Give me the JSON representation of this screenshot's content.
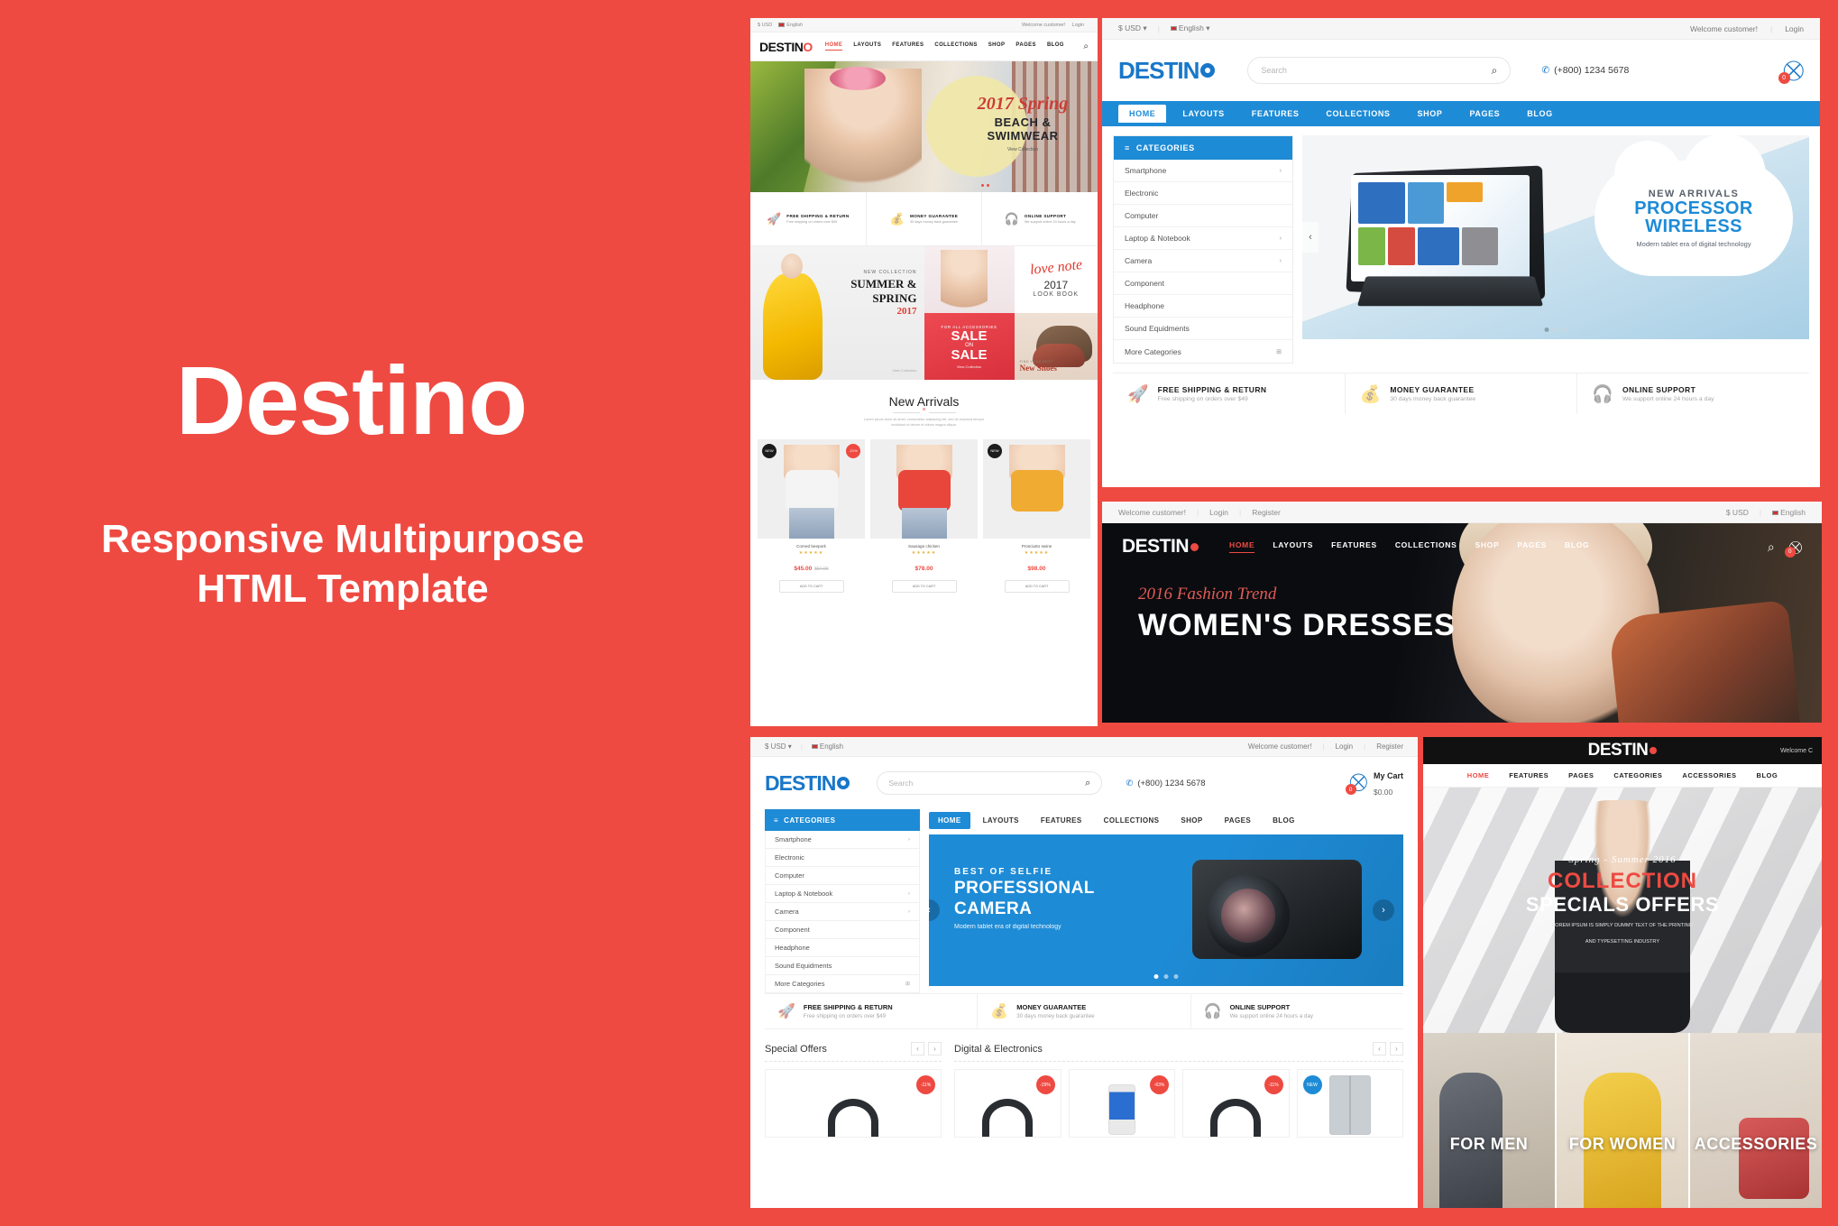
{
  "brand": {
    "name": "Destino",
    "accent": "#ee4a42",
    "blue": "#1e8bd6"
  },
  "hero": {
    "title": "Destino",
    "subtitle": "Responsive Multipurpose\nHTML Template",
    "subtitle_line1": "Responsive Multipurpose",
    "subtitle_line2": "HTML Template"
  },
  "common": {
    "currency": "$ USD",
    "language": "English",
    "welcome": "Welcome customer!",
    "login": "Login",
    "register": "Register",
    "search_placeholder": "Search",
    "phone": "(+800) 1234 5678",
    "cart_count": "0",
    "cart_label": "My Cart",
    "cart_total": "$0.00",
    "categories_title": "CATEGORIES",
    "caret": "▾",
    "arrow_right": "›",
    "arrow_left": "‹",
    "plus": "⊞"
  },
  "categories": [
    {
      "label": "Smartphone",
      "has_sub": true
    },
    {
      "label": "Electronic",
      "has_sub": false
    },
    {
      "label": "Computer",
      "has_sub": false
    },
    {
      "label": "Laptop & Notebook",
      "has_sub": true
    },
    {
      "label": "Camera",
      "has_sub": true
    },
    {
      "label": "Component",
      "has_sub": false
    },
    {
      "label": "Headphone",
      "has_sub": false
    },
    {
      "label": "Sound Equidments",
      "has_sub": false
    },
    {
      "label": "More Categories",
      "has_sub": false
    }
  ],
  "services": [
    {
      "title": "FREE SHIPPING & RETURN",
      "sub": "Free shipping on orders over $49",
      "icon": "rocket-icon"
    },
    {
      "title": "MONEY GUARANTEE",
      "sub": "30 days money back guarantee",
      "icon": "money-bag-icon"
    },
    {
      "title": "ONLINE SUPPORT",
      "sub": "We support online 24 hours a day",
      "icon": "headset-icon"
    }
  ],
  "panel_fashion_light": {
    "nav": [
      "HOME",
      "LAYOUTS",
      "FEATURES",
      "COLLECTIONS",
      "SHOP",
      "PAGES",
      "BLOG"
    ],
    "active_nav": "HOME",
    "logo": "DESTINO",
    "hero": {
      "script_line": "2017 Spring",
      "headline_line1": "BEACH &",
      "headline_line2": "SWIMWEAR",
      "cta": "View Collection"
    },
    "promos": {
      "summer": {
        "kicker": "NEW COLLECTION",
        "title": "SUMMER & SPRING",
        "year": "2017",
        "cta": "View Collection"
      },
      "lookbook": {
        "script": "love note",
        "year": "2017",
        "label": "LOOK BOOK"
      },
      "sale": {
        "kicker": "FOR ALL ACCESSORIES",
        "l1": "SALE",
        "l2": "ON",
        "l3": "SALE",
        "cta": "View Collection"
      },
      "shoes": {
        "kicker": "FIND YOUR BEST",
        "title": "New Shoes"
      }
    },
    "new_arrivals": {
      "heading": "New Arrivals",
      "sub_line1": "Lorem ipsum dolor sit amet, consectetur adipiscing elit, sed do eiusmod tempor",
      "sub_line2": "incididunt ut labore et dolore magna aliqua.",
      "products": [
        {
          "name": "Corned beepork",
          "stars": "★★★★★",
          "price": "$45.00",
          "old_price": "$57.00",
          "badge_new": "NEW",
          "badge_off": "-21%",
          "cta": "ADD TO CART"
        },
        {
          "name": "Sausage chicken",
          "stars": "★★★★★",
          "price": "$78.00",
          "old_price": "",
          "badge_new": "",
          "badge_off": "",
          "cta": "ADD TO CART"
        },
        {
          "name": "Prosciutto swine",
          "stars": "★★★★★",
          "price": "$98.00",
          "old_price": "",
          "badge_new": "NEW",
          "badge_off": "",
          "cta": "ADD TO CART"
        }
      ]
    }
  },
  "panel_electronics_top": {
    "logo": "DESTINO",
    "nav": [
      "HOME",
      "LAYOUTS",
      "FEATURES",
      "COLLECTIONS",
      "SHOP",
      "PAGES",
      "BLOG"
    ],
    "active_nav": "HOME",
    "banner": {
      "kicker": "NEW ARRIVALS",
      "title_line1": "PROCESSOR",
      "title_line2": "WIRELESS",
      "sub": "Modern tablet era of digital technology"
    },
    "slide_dots": 3,
    "active_dot": 1
  },
  "panel_fashion_dark": {
    "logo": "DESTINO",
    "nav": [
      "HOME",
      "LAYOUTS",
      "FEATURES",
      "COLLECTIONS",
      "SHOP",
      "PAGES",
      "BLOG"
    ],
    "active_nav": "HOME",
    "hero": {
      "script_line": "2016 Fashion Trend",
      "headline": "WOMEN'S DRESSES"
    }
  },
  "panel_electronics_bottom": {
    "logo": "DESTINO",
    "nav": [
      "HOME",
      "LAYOUTS",
      "FEATURES",
      "COLLECTIONS",
      "SHOP",
      "PAGES",
      "BLOG"
    ],
    "active_nav": "HOME",
    "banner": {
      "kicker": "BEST OF SELFIE",
      "title_line1": "PROFESSIONAL",
      "title_line2": "CAMERA",
      "sub": "Modern tablet era of digital technology"
    },
    "sections": [
      {
        "title": "Special Offers"
      },
      {
        "title": "Digital & Electronics"
      }
    ],
    "cards": [
      {
        "badge": "-11%",
        "type": "headphone"
      },
      {
        "badge": "-29%",
        "type": "headphone"
      },
      {
        "badge": "-63%",
        "type": "phone"
      },
      {
        "badge": "-11%",
        "type": "headphone"
      },
      {
        "badge": "NEW",
        "type": "fridge"
      }
    ]
  },
  "panel_fashion_bottom": {
    "logo": "DESTINO",
    "welcome": "Welcome C",
    "nav": [
      "HOME",
      "FEATURES",
      "PAGES",
      "CATEGORIES",
      "ACCESSORIES",
      "BLOG"
    ],
    "active_nav": "HOME",
    "hero": {
      "script_line": "Spring - Summer 2016",
      "title_line1": "COLLECTION",
      "title_line2": "SPECIALS OFFERS",
      "sub_line1": "LOREM IPSUM IS SIMPLY DUMMY TEXT OF THE PRINTING",
      "sub_line2": "AND TYPESETTING INDUSTRY"
    },
    "cards": [
      {
        "label": "FOR MEN"
      },
      {
        "label": "FOR WOMEN"
      },
      {
        "label": "ACCESSORIES"
      }
    ]
  }
}
